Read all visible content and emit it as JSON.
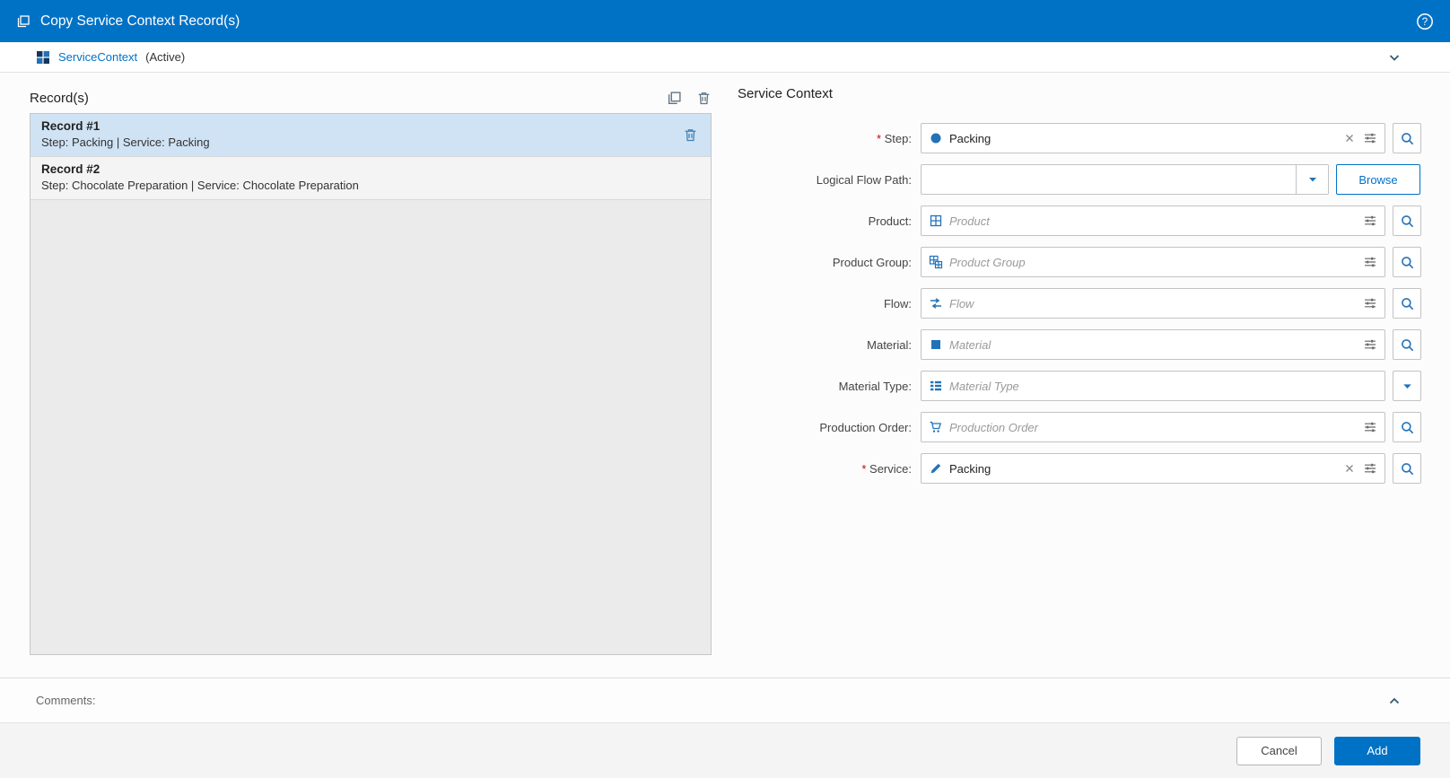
{
  "colors": {
    "accent": "#0072c6",
    "selected_record_bg": "#cfe3f4",
    "icon_blue": "#2272b8"
  },
  "header": {
    "title": "Copy Service Context Record(s)",
    "icon": "copy",
    "help_icon": "question-circle"
  },
  "context_bar": {
    "name": "ServiceContext",
    "status": "(Active)",
    "icon": "service-context-tiles",
    "collapse_icon": "chevron-down"
  },
  "records_panel": {
    "title": "Record(s)",
    "action_icons": [
      "copy",
      "trash"
    ],
    "records": [
      {
        "title": "Record #1",
        "subtitle": "Step: Packing | Service: Packing",
        "selected": true
      },
      {
        "title": "Record #2",
        "subtitle": "Step: Chocolate Preparation | Service: Chocolate Preparation",
        "selected": false
      }
    ]
  },
  "form": {
    "title": "Service Context",
    "fields": [
      {
        "label": "Step:",
        "required": true,
        "type": "lookup",
        "icon": "circle",
        "value": "Packing",
        "clearable": true
      },
      {
        "label": "Logical Flow Path:",
        "required": false,
        "type": "dropdown-browse",
        "value": "",
        "browse_label": "Browse"
      },
      {
        "label": "Product:",
        "required": false,
        "type": "lookup",
        "icon": "product-grid",
        "placeholder": "Product"
      },
      {
        "label": "Product Group:",
        "required": false,
        "type": "lookup",
        "icon": "product-group-grid",
        "placeholder": "Product Group"
      },
      {
        "label": "Flow:",
        "required": false,
        "type": "lookup",
        "icon": "flow-arrows",
        "placeholder": "Flow"
      },
      {
        "label": "Material:",
        "required": false,
        "type": "lookup",
        "icon": "material-square",
        "placeholder": "Material"
      },
      {
        "label": "Material Type:",
        "required": false,
        "type": "dropdown",
        "icon": "material-type-list",
        "placeholder": "Material Type"
      },
      {
        "label": "Production Order:",
        "required": false,
        "type": "lookup",
        "icon": "cart",
        "placeholder": "Production Order"
      },
      {
        "label": "Service:",
        "required": true,
        "type": "lookup",
        "icon": "pencil",
        "value": "Packing",
        "clearable": true
      }
    ]
  },
  "comments": {
    "label": "Comments:",
    "collapse_icon": "chevron-up"
  },
  "footer": {
    "cancel_label": "Cancel",
    "add_label": "Add"
  }
}
